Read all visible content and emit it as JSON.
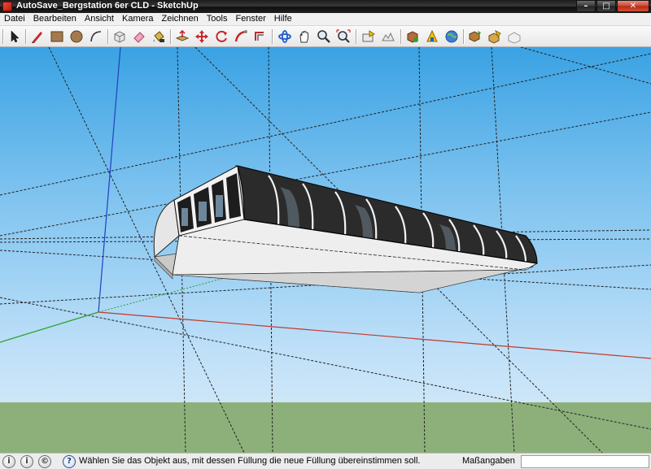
{
  "window": {
    "title": "AutoSave_Bergstation 6er CLD - SketchUp",
    "minimize_glyph": "–",
    "maximize_glyph": "□",
    "close_glyph": "✕"
  },
  "menu": {
    "items": [
      "Datei",
      "Bearbeiten",
      "Ansicht",
      "Kamera",
      "Zeichnen",
      "Tools",
      "Fenster",
      "Hilfe"
    ]
  },
  "toolbar": {
    "tools": [
      "select-icon",
      "pencil-icon",
      "rectangle-icon",
      "circle-icon",
      "arc-icon",
      "make-component-icon",
      "eraser-icon",
      "paint-bucket-icon",
      "push-pull-icon",
      "move-icon",
      "rotate-icon",
      "follow-me-icon",
      "offset-icon",
      "orbit-icon",
      "pan-icon",
      "zoom-icon",
      "zoom-extents-icon",
      "add-location-icon",
      "toggle-terrain-icon",
      "get-models-icon",
      "share-model-icon",
      "google-earth-icon",
      "get-photo-icon",
      "share-component-icon",
      "warehouse-icon"
    ]
  },
  "status": {
    "icon_1": "i",
    "icon_2": "i",
    "icon_3": "©",
    "help_glyph": "?",
    "message": "Wählen Sie das Objekt aus, mit dessen Füllung die neue Füllung übereinstimmen soll.",
    "measurements_label": "Maßangaben",
    "measurements_value": ""
  },
  "colors": {
    "sky_top": "#3aa2e3",
    "sky_bottom": "#dcecf8",
    "ground": "#8db07a",
    "axis_red": "#c0392b",
    "axis_green": "#2ca02c",
    "axis_blue": "#2040c0"
  }
}
